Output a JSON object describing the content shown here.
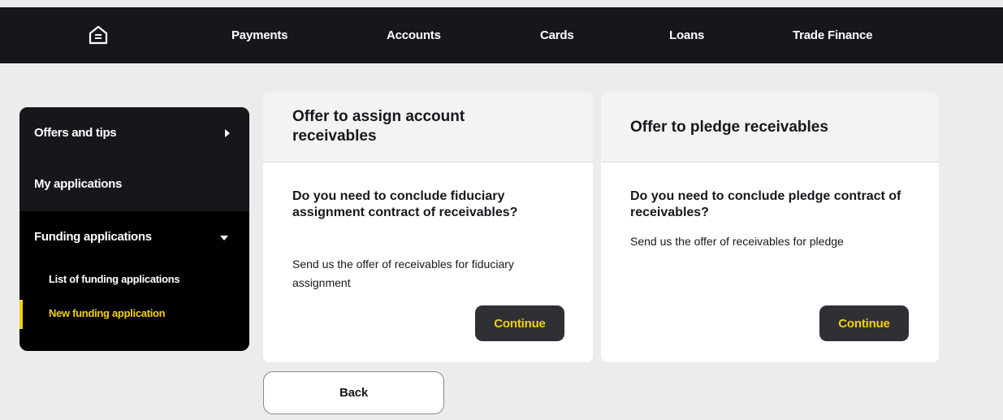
{
  "topnav": {
    "home_icon": "home-icon",
    "items": [
      {
        "label": "Payments"
      },
      {
        "label": "Accounts"
      },
      {
        "label": "Cards"
      },
      {
        "label": "Loans"
      },
      {
        "label": "Trade Finance"
      }
    ]
  },
  "sidebar": {
    "offers_tips": "Offers and tips",
    "my_applications": "My applications",
    "funding_applications": "Funding applications",
    "sub_items": [
      {
        "label": "List of funding applications",
        "active": false
      },
      {
        "label": "New funding application",
        "active": true
      }
    ]
  },
  "cards": [
    {
      "title": "Offer to assign account receivables",
      "question": "Do you need to conclude fiduciary assignment contract of receivables?",
      "text": "Send us the offer of receivables for fiduciary assignment",
      "button": "Continue"
    },
    {
      "title": "Offer to pledge receivables",
      "question": "Do you need to conclude pledge contract of receivables?",
      "text": "Send us the offer of receivables for pledge",
      "button": "Continue"
    }
  ],
  "back_button": "Back",
  "colors": {
    "nav_bg": "#15171b",
    "accent": "#f5d10c",
    "page_bg": "#ececec",
    "button_bg": "#2e3035"
  }
}
